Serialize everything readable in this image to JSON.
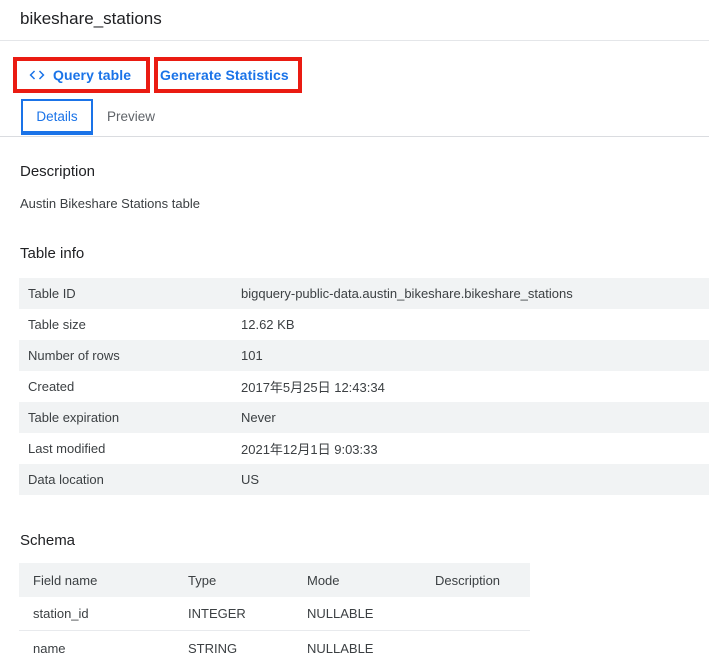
{
  "page": {
    "title": "bikeshare_stations"
  },
  "toolbar": {
    "query_table_label": "Query table",
    "query_table_icon": "code-icon",
    "generate_statistics_label": "Generate Statistics"
  },
  "annotations": {
    "color": "#ea1b12",
    "boxes": [
      "query-table-highlight",
      "generate-statistics-highlight"
    ]
  },
  "colors": {
    "accent": "#1a73e8"
  },
  "tabs": [
    {
      "label": "Details",
      "active": true
    },
    {
      "label": "Preview",
      "active": false
    }
  ],
  "description": {
    "heading": "Description",
    "text": "Austin Bikeshare Stations table"
  },
  "table_info": {
    "heading": "Table info",
    "rows": [
      {
        "label": "Table ID",
        "value": "bigquery-public-data.austin_bikeshare.bikeshare_stations"
      },
      {
        "label": "Table size",
        "value": "12.62 KB"
      },
      {
        "label": "Number of rows",
        "value": "101"
      },
      {
        "label": "Created",
        "value": "2017年5月25日 12:43:34"
      },
      {
        "label": "Table expiration",
        "value": "Never"
      },
      {
        "label": "Last modified",
        "value": "2021年12月1日 9:03:33"
      },
      {
        "label": "Data location",
        "value": "US"
      }
    ]
  },
  "schema": {
    "heading": "Schema",
    "columns": [
      "Field name",
      "Type",
      "Mode",
      "Description"
    ],
    "rows": [
      {
        "field_name": "station_id",
        "type": "INTEGER",
        "mode": "NULLABLE",
        "description": ""
      },
      {
        "field_name": "name",
        "type": "STRING",
        "mode": "NULLABLE",
        "description": ""
      }
    ]
  }
}
